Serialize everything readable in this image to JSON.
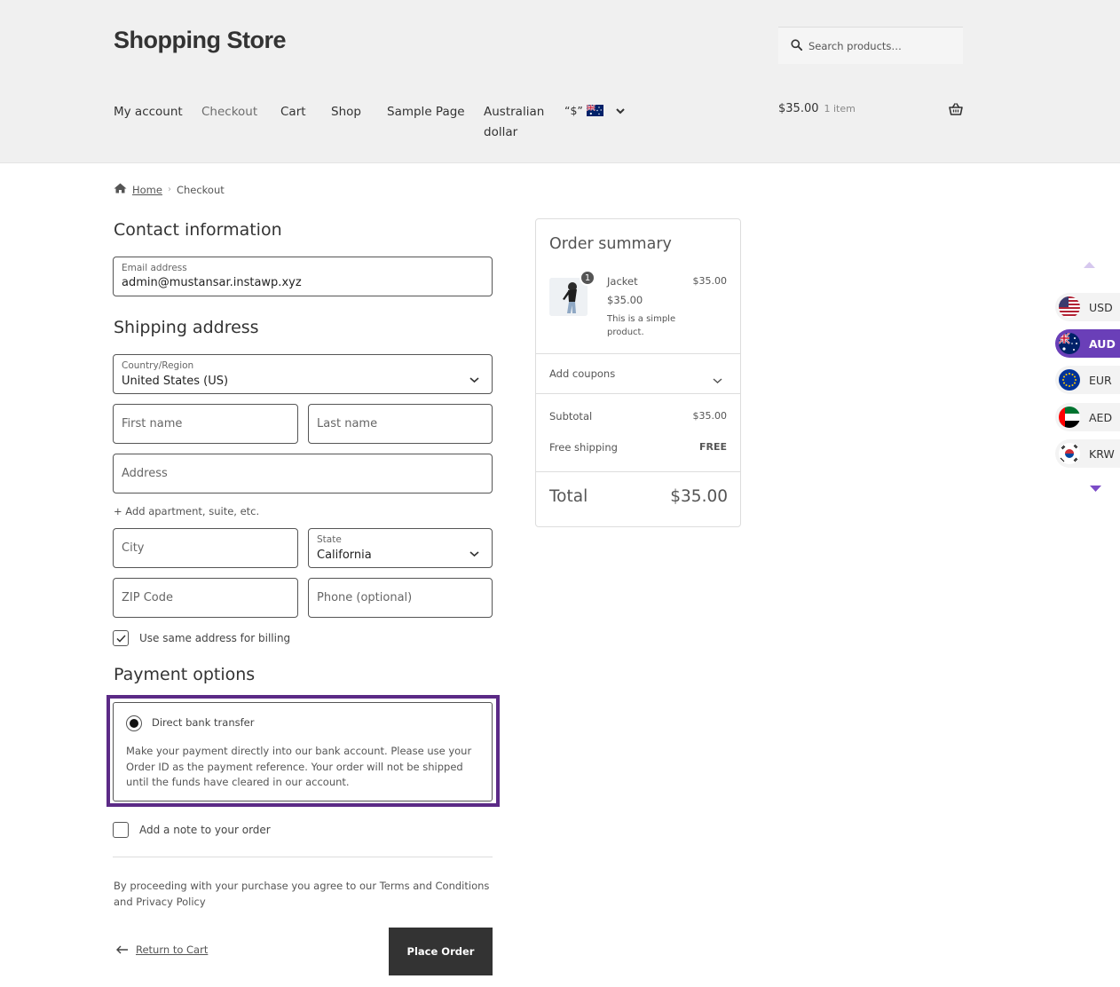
{
  "site": {
    "title": "Shopping Store"
  },
  "search": {
    "placeholder": "Search products…",
    "icon": "search-icon"
  },
  "nav": {
    "items": [
      "My account",
      "Checkout",
      "Cart",
      "Shop",
      "Sample Page",
      "Australian",
      "dollar"
    ],
    "currency_symbol": "“$”",
    "currency_flag": "australia-flag-icon"
  },
  "cart": {
    "amount": "$35.00",
    "count": "1 item",
    "icon": "basket-icon"
  },
  "breadcrumb": {
    "home": "Home",
    "current": "Checkout",
    "icon": "home-icon"
  },
  "contact": {
    "heading": "Contact information",
    "email_label": "Email address",
    "email_value": "admin@mustansar.instawp.xyz"
  },
  "shipping": {
    "heading": "Shipping address",
    "country_label": "Country/Region",
    "country_value": "United States (US)",
    "first_name": "First name",
    "last_name": "Last name",
    "address": "Address",
    "add_apartment": "+ Add apartment, suite, etc.",
    "city": "City",
    "state_label": "State",
    "state_value": "California",
    "zip": "ZIP Code",
    "phone": "Phone (optional)",
    "same_billing": "Use same address for billing",
    "same_billing_checked": true
  },
  "payment": {
    "heading": "Payment options",
    "method": "Direct bank transfer",
    "description": "Make your payment directly into our bank account. Please use your Order ID as the payment reference. Your order will not be shipped until the funds have cleared in our account.",
    "highlight_color": "#5b2a86"
  },
  "note": {
    "label": "Add a note to your order",
    "checked": false
  },
  "terms": {
    "text": "By proceeding with your purchase you agree to our Terms and Conditions and Privacy Policy"
  },
  "actions": {
    "return_label": "Return to Cart",
    "place_order": "Place Order"
  },
  "summary": {
    "heading": "Order summary",
    "item": {
      "name": "Jacket",
      "unit_price": "$35.00",
      "description": "This is a simple product.",
      "quantity": "1",
      "total": "$35.00"
    },
    "coupons": "Add coupons",
    "subtotal_label": "Subtotal",
    "subtotal_value": "$35.00",
    "shipping_label": "Free shipping",
    "shipping_value": "FREE",
    "total_label": "Total",
    "total_value": "$35.00"
  },
  "currency_switcher": {
    "items": [
      "USD",
      "AUD",
      "EUR",
      "AED",
      "KRW"
    ],
    "active": "AUD",
    "active_color": "#6a3fb8"
  }
}
